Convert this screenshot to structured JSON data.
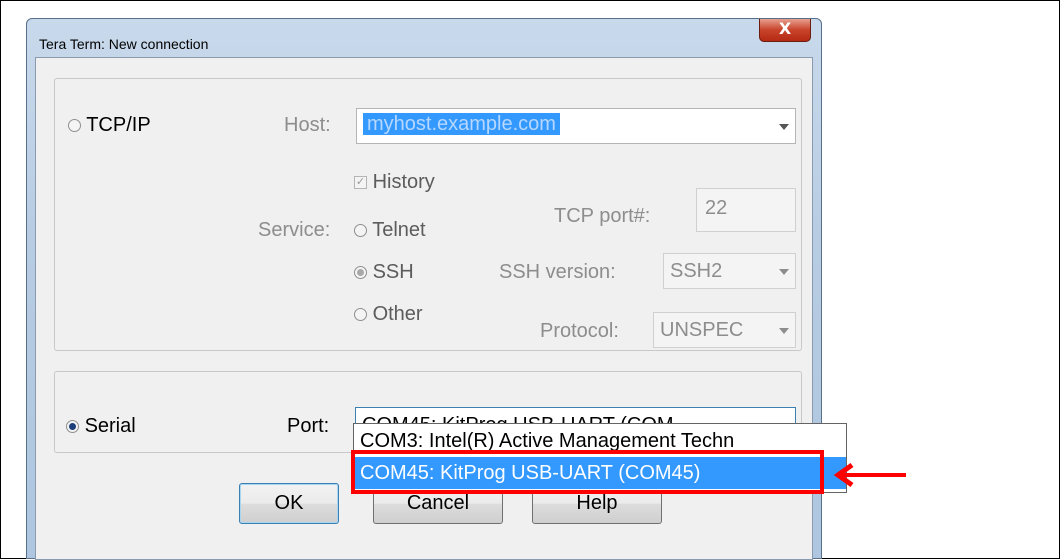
{
  "window": {
    "title": "Tera Term: New connection",
    "close_glyph": "X"
  },
  "tcpip": {
    "label": "TCP/IP",
    "host_label": "Host:",
    "host_value": "myhost.example.com",
    "history_label": "History",
    "service_label": "Service:",
    "telnet_label": "Telnet",
    "ssh_label": "SSH",
    "other_label": "Other",
    "tcp_port_label": "TCP port#:",
    "tcp_port_value": "22",
    "ssh_version_label": "SSH version:",
    "ssh_version_value": "SSH2",
    "protocol_label": "Protocol:",
    "protocol_value": "UNSPEC"
  },
  "serial": {
    "label": "Serial",
    "port_label": "Port:",
    "port_value": "COM45: KitProg USB-UART (COM",
    "options": [
      "COM3: Intel(R) Active Management Techn",
      "COM45: KitProg USB-UART (COM45)"
    ]
  },
  "buttons": {
    "ok": "OK",
    "cancel": "Cancel",
    "help": "Help"
  },
  "annotation": {
    "color": "#ff0000"
  }
}
